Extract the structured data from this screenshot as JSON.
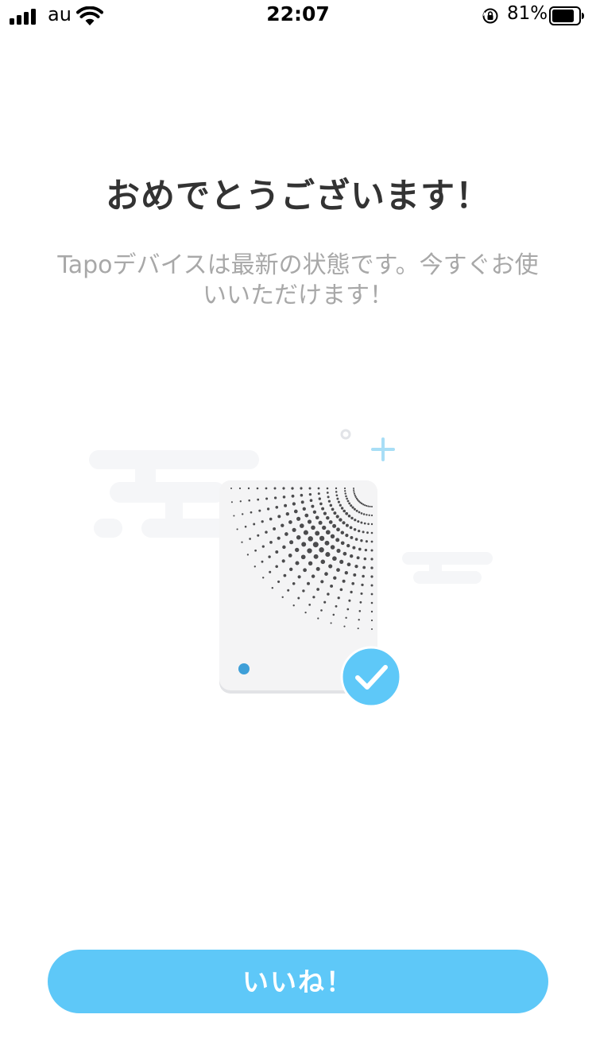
{
  "status_bar": {
    "carrier": "au",
    "time": "22:07",
    "battery_percent": "81%",
    "signal_bars": 4,
    "battery_level": 0.81,
    "icons": [
      "signal-icon",
      "wifi-icon",
      "rotation-lock-icon",
      "battery-icon"
    ]
  },
  "main": {
    "title": "おめでとうございます！",
    "subtitle_line1": "Tapoデバイスは最新の状態です。今すぐお使",
    "subtitle_line2": "いいただけます！"
  },
  "illustration": {
    "icons": [
      "tapo-device-icon",
      "check-badge-icon",
      "sparkle-plus-icon",
      "sparkle-dot-icon",
      "cloud-icon"
    ]
  },
  "actions": {
    "ok_label": "いいね！"
  },
  "colors": {
    "accent": "#5ec8f8",
    "title": "#333333",
    "subtitle": "#a8a8a8",
    "device_led": "#3e9fd8",
    "check_badge": "#5ec8f8"
  }
}
